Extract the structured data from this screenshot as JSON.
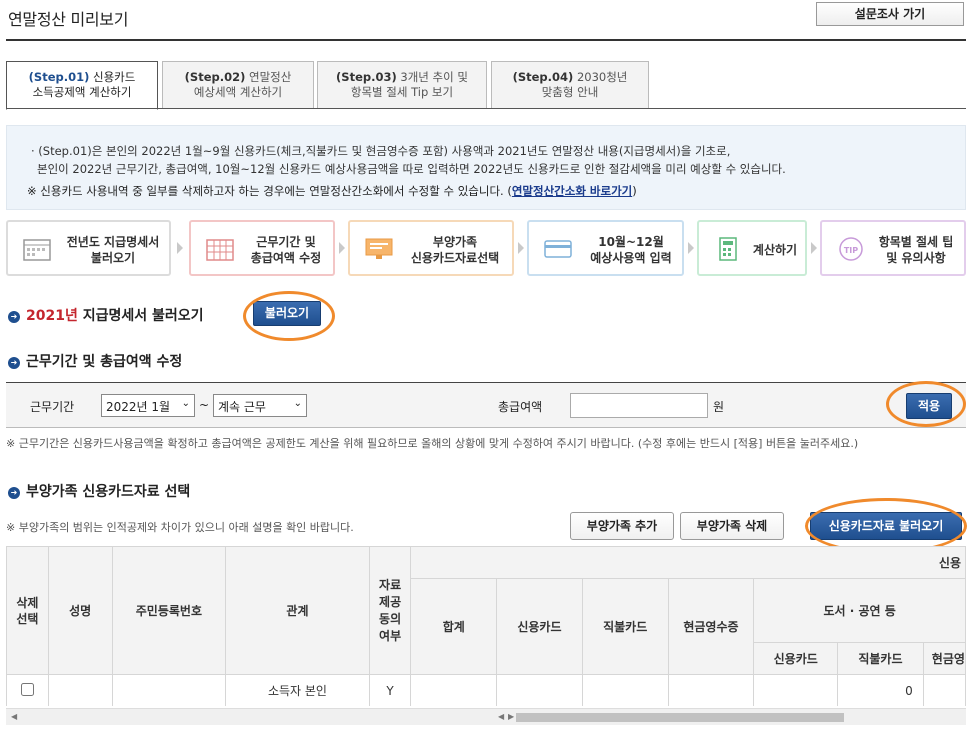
{
  "header": {
    "title": "연말정산 미리보기",
    "survey_button": "설문조사 가기"
  },
  "tabs": [
    {
      "step": "(Step.01)",
      "line1": "신용카드",
      "line2": "소득공제액 계산하기",
      "active": true
    },
    {
      "step": "(Step.02)",
      "line1": "연말정산",
      "line2": "예상세액 계산하기",
      "active": false
    },
    {
      "step": "(Step.03)",
      "line1": "3개년 추이 및",
      "line2": "항목별 절세 Tip 보기",
      "active": false
    },
    {
      "step": "(Step.04)",
      "line1": "2030청년",
      "line2": "맞춤형 안내",
      "active": false
    }
  ],
  "notice": {
    "line1": "· (Step.01)은 본인의 2022년 1월~9월 신용카드(체크,직불카드 및 현금영수증 포함) 사용액과 2021년도 연말정산 내용(지급명세서)을 기초로,",
    "line2": "본인이 2022년 근무기간, 총급여액, 10월~12월 신용카드 예상사용금액을 따로 입력하면 2022년도 신용카드로 인한 절감세액을 미리 예상할 수 있습니다.",
    "line3": "※ 신용카드 사용내역 중 일부를 삭제하고자 하는 경우에는 연말정산간소화에서 수정할 수 있습니다. (",
    "link": "연말정산간소화 바로가기",
    "line3_end": ")"
  },
  "process_steps": [
    {
      "line1": "전년도 지급명세서",
      "line2": "불러오기",
      "icon": "calendar-icon",
      "border": "#dcdcdc"
    },
    {
      "line1": "근무기간 및",
      "line2": "총급여액 수정",
      "icon": "calendar-grid-icon",
      "border": "#f3c6c6"
    },
    {
      "line1": "부양가족",
      "line2": "신용카드자료선택",
      "icon": "monitor-icon",
      "border": "#f6d9b8"
    },
    {
      "line1": "10월~12월",
      "line2": "예상사용액 입력",
      "icon": "card-icon",
      "border": "#c9dff0"
    },
    {
      "line1": "계산하기",
      "line2": "",
      "icon": "calculator-icon",
      "border": "#c9ecd6"
    },
    {
      "line1": "항목별 절세 팁",
      "line2": "및 유의사항",
      "icon": "tip-icon",
      "border": "#e3cdec"
    }
  ],
  "section1": {
    "year": "2021년",
    "title": "지급명세서 불러오기",
    "button": "불러오기"
  },
  "section2": {
    "title": "근무기간 및 총급여액 수정",
    "period_label": "근무기간",
    "start_value": "2022년 1월",
    "tilde": "~",
    "end_value": "계속 근무",
    "salary_label": "총급여액",
    "salary_value": "",
    "unit": "원",
    "apply_button": "적용",
    "note": "※ 근무기간은 신용카드사용금액을 확정하고 총급여액은 공제한도 계산을 위해 필요하므로 올해의 상황에 맞게 수정하여 주시기 바랍니다. (수정 후에는 반드시 [적용] 버튼을 눌러주세요.)"
  },
  "section3": {
    "title": "부양가족 신용카드자료 선택",
    "note": "※ 부양가족의 범위는 인적공제와 차이가 있으니 아래 설명을 확인 바랍니다.",
    "add_button": "부양가족 추가",
    "delete_button": "부양가족 삭제",
    "load_button": "신용카드자료 불러오기"
  },
  "table": {
    "col_delete": "삭제\n선택",
    "col_name": "성명",
    "col_rrn": "주민등록번호",
    "col_relation": "관계",
    "col_consent": "자료\n제공\n동의\n여부",
    "group_top": "신용",
    "col_total": "합계",
    "col_credit": "신용카드",
    "col_debit": "직불카드",
    "col_cash": "현금영수증",
    "group_books": "도서 · 공연 등",
    "sub_credit": "신용카드",
    "sub_debit": "직불카드",
    "sub_cash": "현금영",
    "rows": [
      {
        "name": "",
        "rrn": "",
        "relation": "소득자 본인",
        "consent": "Y",
        "total": "",
        "credit": "",
        "debit": "",
        "cash": "",
        "book_credit": "",
        "book_debit": "0",
        "book_cash": ""
      }
    ]
  },
  "colors": {
    "accent": "#1f4f8f",
    "highlight": "#f08a2c",
    "year_red": "#c4262e",
    "notice_bg": "#eef4fa"
  }
}
